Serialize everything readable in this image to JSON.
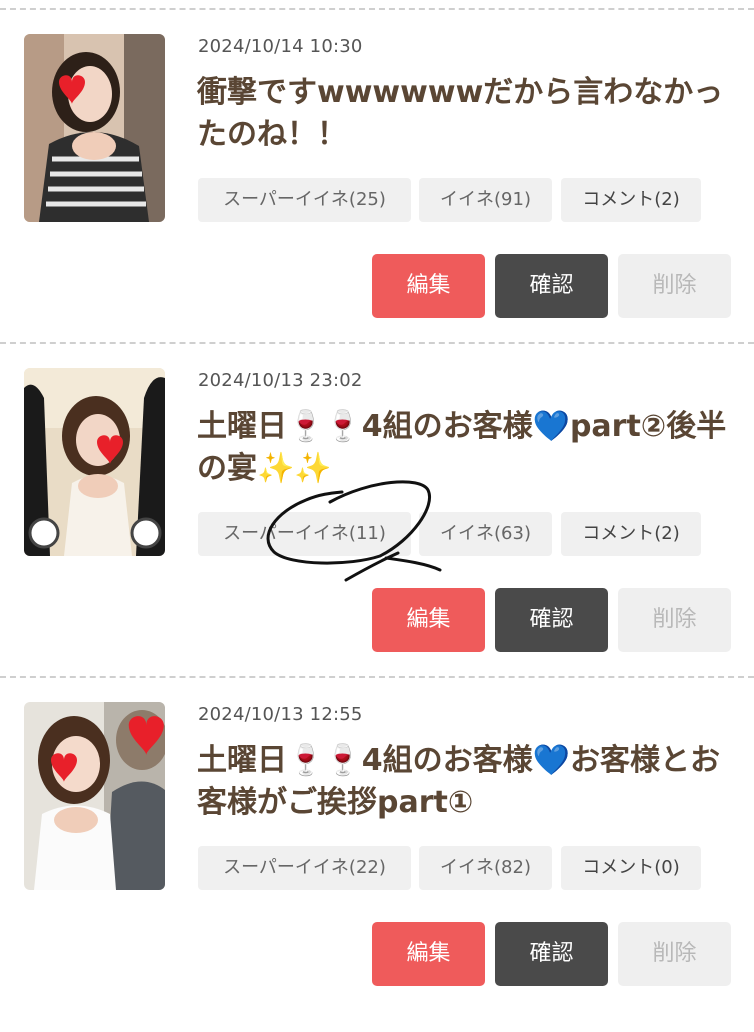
{
  "posts": [
    {
      "datetime": "2024/10/14 10:30",
      "title": "衝撃ですwwwwwwだから言わなかったのね！！",
      "super_like": "スーパーイイネ(25)",
      "like": "イイネ(91)",
      "comment": "コメント(2)",
      "edit_label": "編集",
      "confirm_label": "確認",
      "delete_label": "削除"
    },
    {
      "datetime": "2024/10/13 23:02",
      "title_a": "土曜日",
      "title_b": "4組のお客様",
      "title_c": "part②後半の宴",
      "super_like": "スーパーイイネ(11)",
      "like": "イイネ(63)",
      "comment": "コメント(2)",
      "edit_label": "編集",
      "confirm_label": "確認",
      "delete_label": "削除"
    },
    {
      "datetime": "2024/10/13 12:55",
      "title_a": "土曜日",
      "title_b": "4組のお客様",
      "title_c": "お客様とお客様がご挨拶part①",
      "super_like": "スーパーイイネ(22)",
      "like": "イイネ(82)",
      "comment": "コメント(0)",
      "edit_label": "編集",
      "confirm_label": "確認",
      "delete_label": "削除"
    }
  ],
  "emoji": {
    "wine": "🍷",
    "blue_heart": "💙",
    "sparkles": "✨"
  },
  "colors": {
    "edit_button": "#ef5b5b",
    "confirm_button": "#4a4a4a",
    "delete_button": "#efefef",
    "title_text": "#5a4634"
  }
}
